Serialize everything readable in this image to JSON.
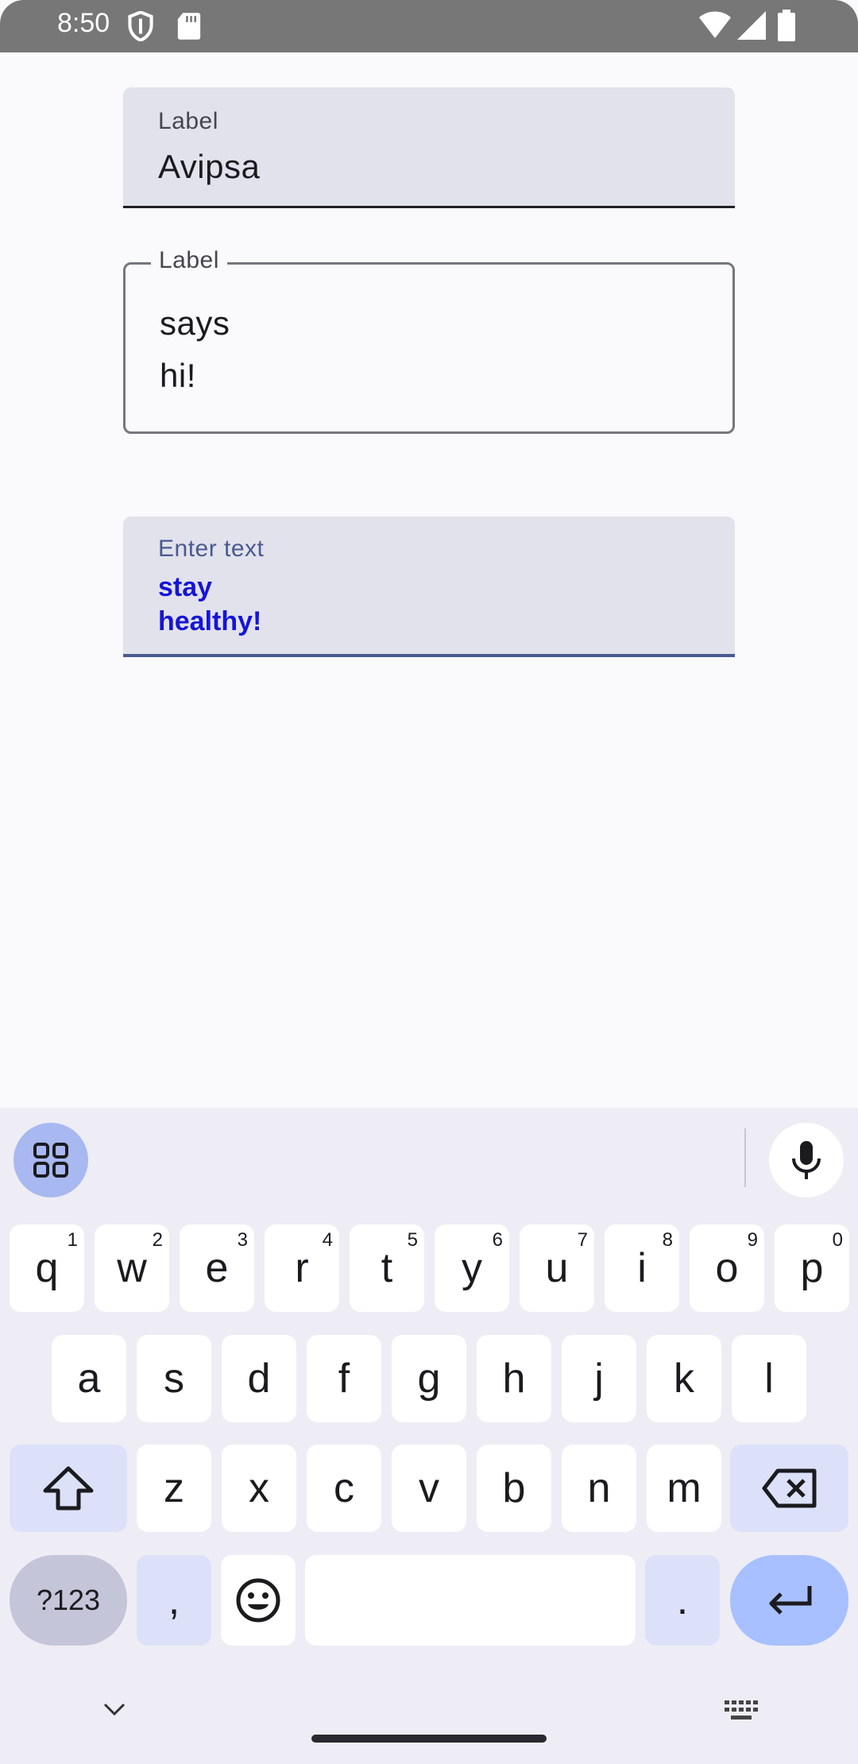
{
  "status_bar": {
    "time": "8:50",
    "icons": [
      "shield-icon",
      "sd-card-icon",
      "wifi-icon",
      "cell-signal-icon",
      "battery-icon"
    ]
  },
  "fields": {
    "name_field": {
      "label": "Label",
      "value": "Avipsa"
    },
    "message_field": {
      "label": "Label",
      "lines": [
        "says",
        "hi!"
      ]
    },
    "text_field": {
      "label": "Enter text",
      "lines": [
        "stay",
        "healthy!"
      ],
      "text_color": "#1515d8"
    }
  },
  "keyboard": {
    "row1": [
      {
        "label": "q",
        "hint": "1"
      },
      {
        "label": "w",
        "hint": "2"
      },
      {
        "label": "e",
        "hint": "3"
      },
      {
        "label": "r",
        "hint": "4"
      },
      {
        "label": "t",
        "hint": "5"
      },
      {
        "label": "y",
        "hint": "6"
      },
      {
        "label": "u",
        "hint": "7"
      },
      {
        "label": "i",
        "hint": "8"
      },
      {
        "label": "o",
        "hint": "9"
      },
      {
        "label": "p",
        "hint": "0"
      }
    ],
    "row2": [
      "a",
      "s",
      "d",
      "f",
      "g",
      "h",
      "j",
      "k",
      "l"
    ],
    "row3": [
      "z",
      "x",
      "c",
      "v",
      "b",
      "n",
      "m"
    ],
    "symbols_label": "?123",
    "comma_label": ",",
    "period_label": "."
  },
  "colors": {
    "accent": "#4a5a91",
    "keyboard_bg": "#eeedf5",
    "enter_key": "#a8c0ff",
    "field_bg": "#e2e2ec"
  }
}
